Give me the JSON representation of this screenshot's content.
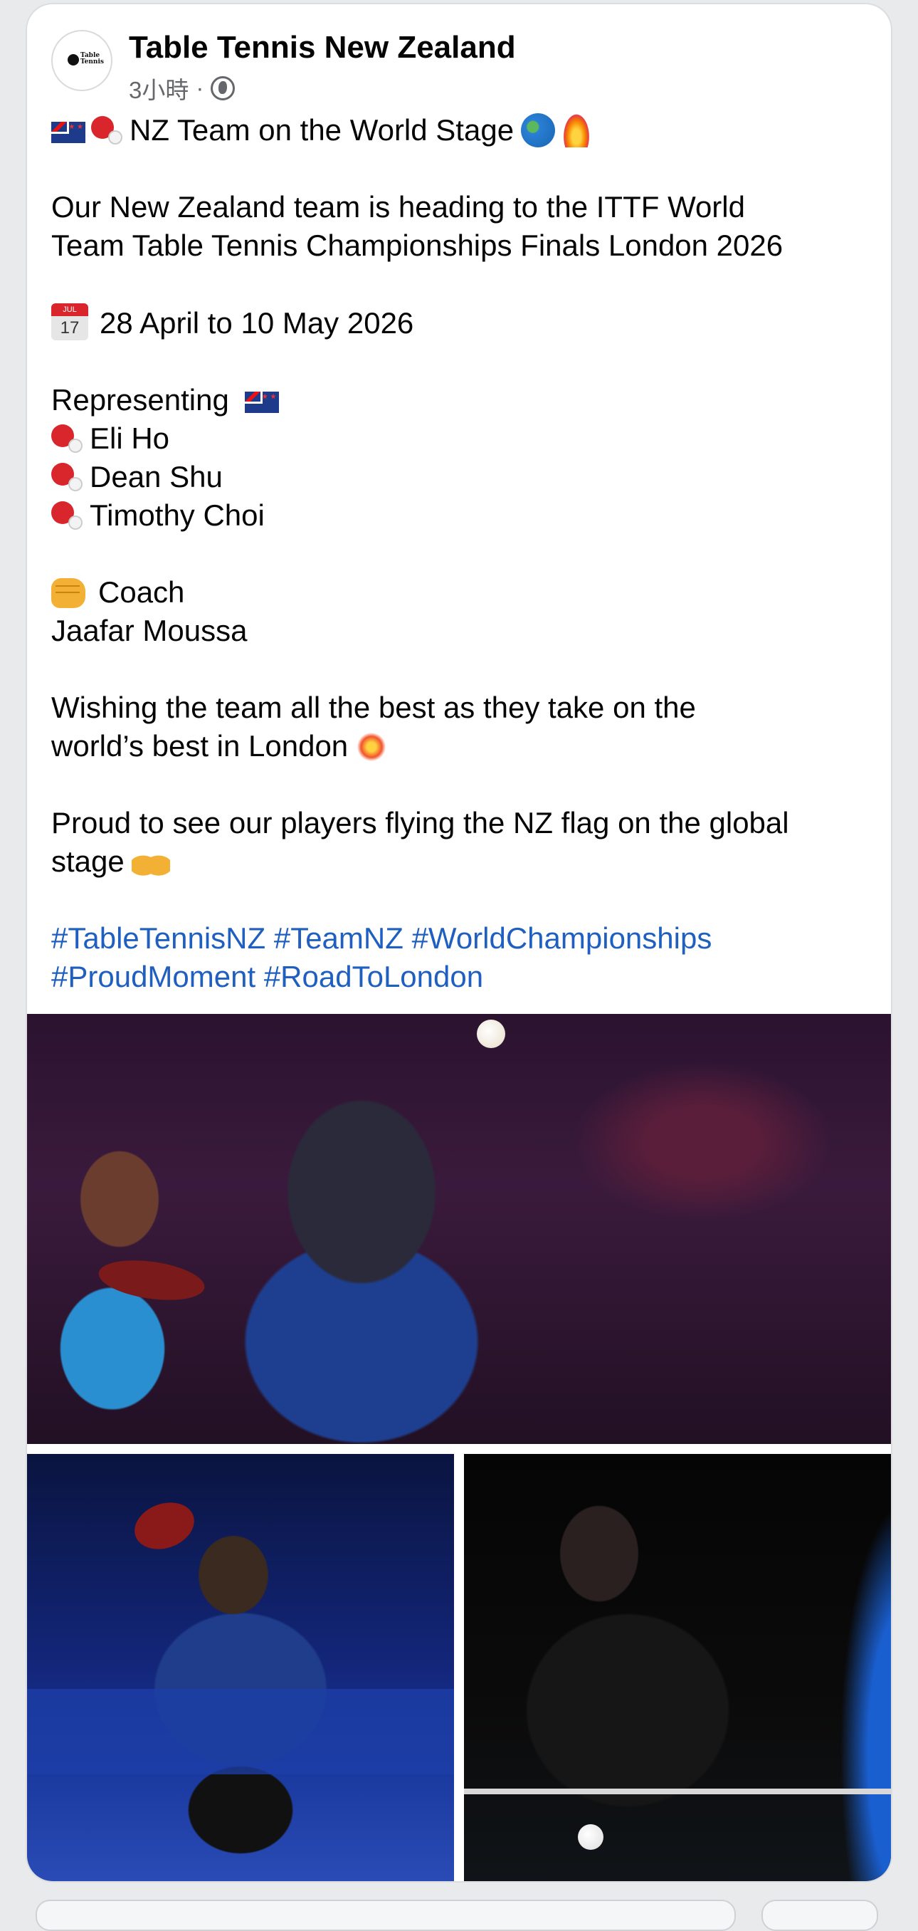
{
  "post": {
    "page_name": "Table Tennis New Zealand",
    "timestamp": "3小時",
    "separator": "·",
    "privacy_icon": "globe-icon",
    "avatar_logo_text": "Table Tennis",
    "headline": "NZ Team on the World Stage",
    "intro_line1": "Our New Zealand team is heading to the ITTF World",
    "intro_line2": "Team Table Tennis Championships Finals London 2026",
    "calendar_month": "JUL",
    "calendar_day": "17",
    "dates": "28 April to 10 May 2026",
    "representing_label": "Representing",
    "players": [
      "Eli Ho",
      "Dean Shu",
      "Timothy Choi"
    ],
    "coach_label": "Coach",
    "coach_name": "Jaafar Moussa",
    "wishing_line1": "Wishing the team all the best as they take on the",
    "wishing_line2": "world’s best in London",
    "proud_line1": "Proud to see our players flying the NZ flag on the global",
    "proud_line2": "stage",
    "hashtags_line1": [
      "#TableTennisNZ",
      "#TeamNZ",
      "#WorldChampionships"
    ],
    "hashtags_line2": [
      "#ProudMoment",
      "#RoadToLondon"
    ]
  },
  "colors": {
    "hashtag": "#1f5fbf",
    "text": "#050505",
    "meta": "#65676b",
    "card_bg": "#ffffff",
    "page_bg": "#e9eaec"
  },
  "icons": {
    "flag": "nz-flag-icon",
    "paddle": "ping-pong-paddle-icon",
    "globe": "globe-showing-emoji-icon",
    "fire": "fire-icon",
    "calendar": "calendar-icon",
    "fist": "oncoming-fist-icon",
    "collision": "collision-icon",
    "raised_hands": "raising-hands-icon"
  }
}
